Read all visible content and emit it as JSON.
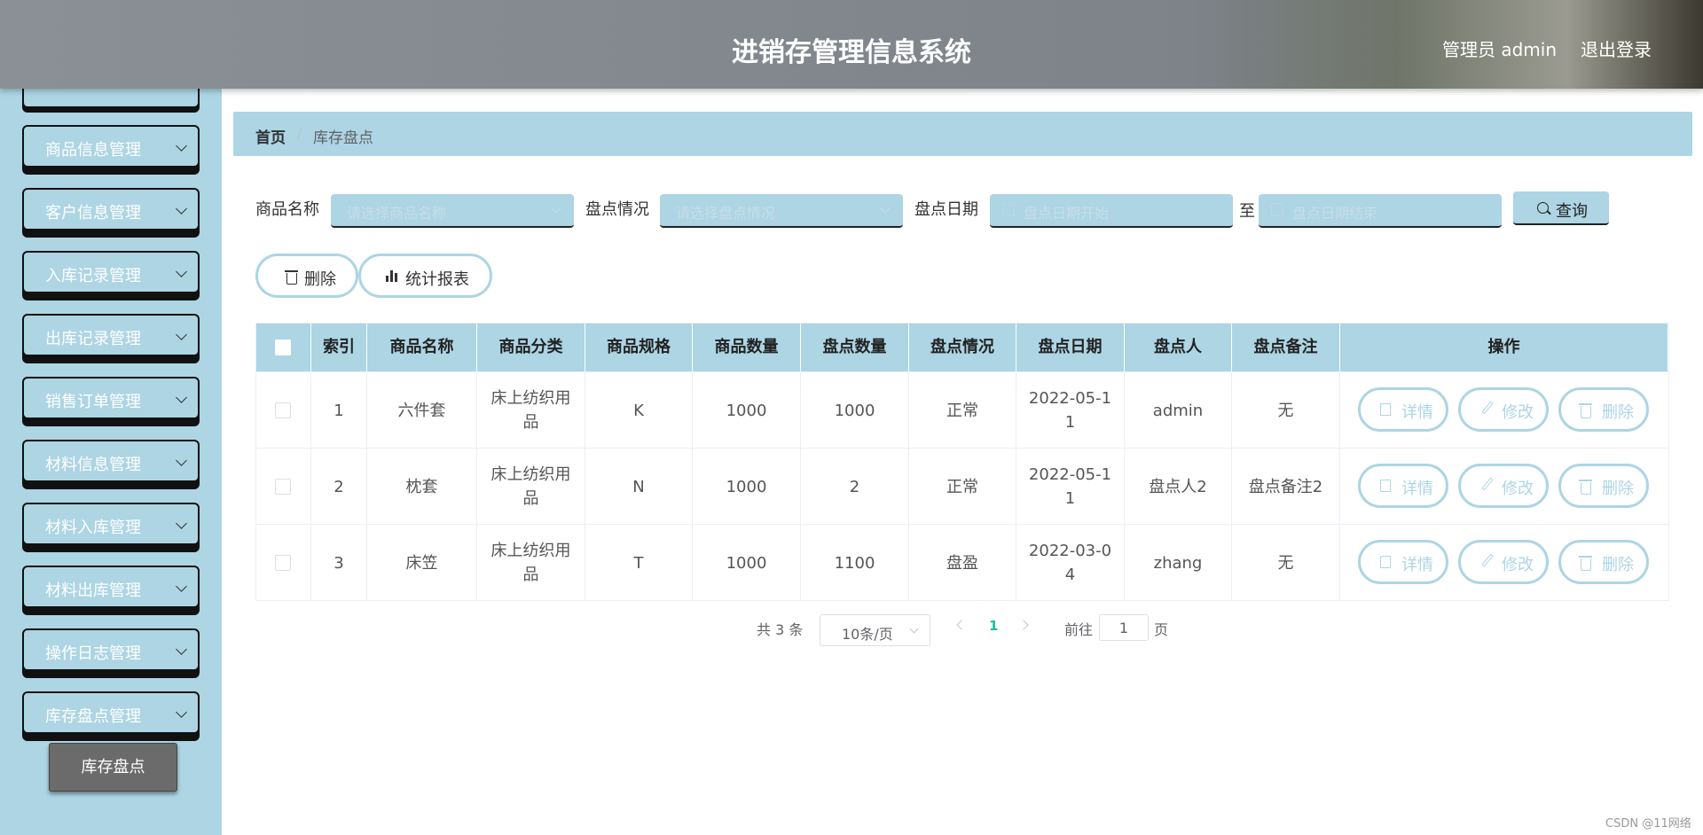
{
  "header": {
    "title": "进销存管理信息系统",
    "user": "管理员 admin",
    "logout": "退出登录"
  },
  "sidebar": {
    "items": [
      {
        "label": "商品信息管理"
      },
      {
        "label": "客户信息管理"
      },
      {
        "label": "入库记录管理"
      },
      {
        "label": "出库记录管理"
      },
      {
        "label": "销售订单管理"
      },
      {
        "label": "材料信息管理"
      },
      {
        "label": "材料入库管理"
      },
      {
        "label": "材料出库管理"
      },
      {
        "label": "操作日志管理"
      },
      {
        "label": "库存盘点管理"
      }
    ],
    "submenu_active": "库存盘点"
  },
  "breadcrumb": {
    "home": "首页",
    "separator": "/",
    "current": "库存盘点"
  },
  "filters": {
    "name_label": "商品名称",
    "name_placeholder": "请选择商品名称",
    "status_label": "盘点情况",
    "status_placeholder": "请选择盘点情况",
    "date_label": "盘点日期",
    "date_start_placeholder": "盘点日期开始",
    "date_to": "至",
    "date_end_placeholder": "盘点日期结束",
    "query": "查询"
  },
  "actions": {
    "delete": "删除",
    "report": "统计报表"
  },
  "table": {
    "headers": [
      "索引",
      "商品名称",
      "商品分类",
      "商品规格",
      "商品数量",
      "盘点数量",
      "盘点情况",
      "盘点日期",
      "盘点人",
      "盘点备注",
      "操作"
    ],
    "rows": [
      {
        "index": "1",
        "name": "六件套",
        "category": "床上纺织用品",
        "spec": "K",
        "qty": "1000",
        "check_qty": "1000",
        "status": "正常",
        "date": "2022-05-11",
        "checker": "admin",
        "remark": "无"
      },
      {
        "index": "2",
        "name": "枕套",
        "category": "床上纺织用品",
        "spec": "N",
        "qty": "1000",
        "check_qty": "2",
        "status": "正常",
        "date": "2022-05-11",
        "checker": "盘点人2",
        "remark": "盘点备注2"
      },
      {
        "index": "3",
        "name": "床笠",
        "category": "床上纺织用品",
        "spec": "T",
        "qty": "1000",
        "check_qty": "1100",
        "status": "盘盈",
        "date": "2022-03-04",
        "checker": "zhang",
        "remark": "无"
      }
    ],
    "op_detail": "详情",
    "op_edit": "修改",
    "op_delete": "删除"
  },
  "pagination": {
    "total": "共 3 条",
    "page_size": "10条/页",
    "current": "1",
    "goto_label": "前往",
    "goto_value": "1",
    "page_suffix": "页"
  },
  "watermark": "CSDN @11网络",
  "colors": {
    "accent": "#add5e4",
    "header_bg": "#7d8389",
    "active_page": "#1abc9c"
  }
}
